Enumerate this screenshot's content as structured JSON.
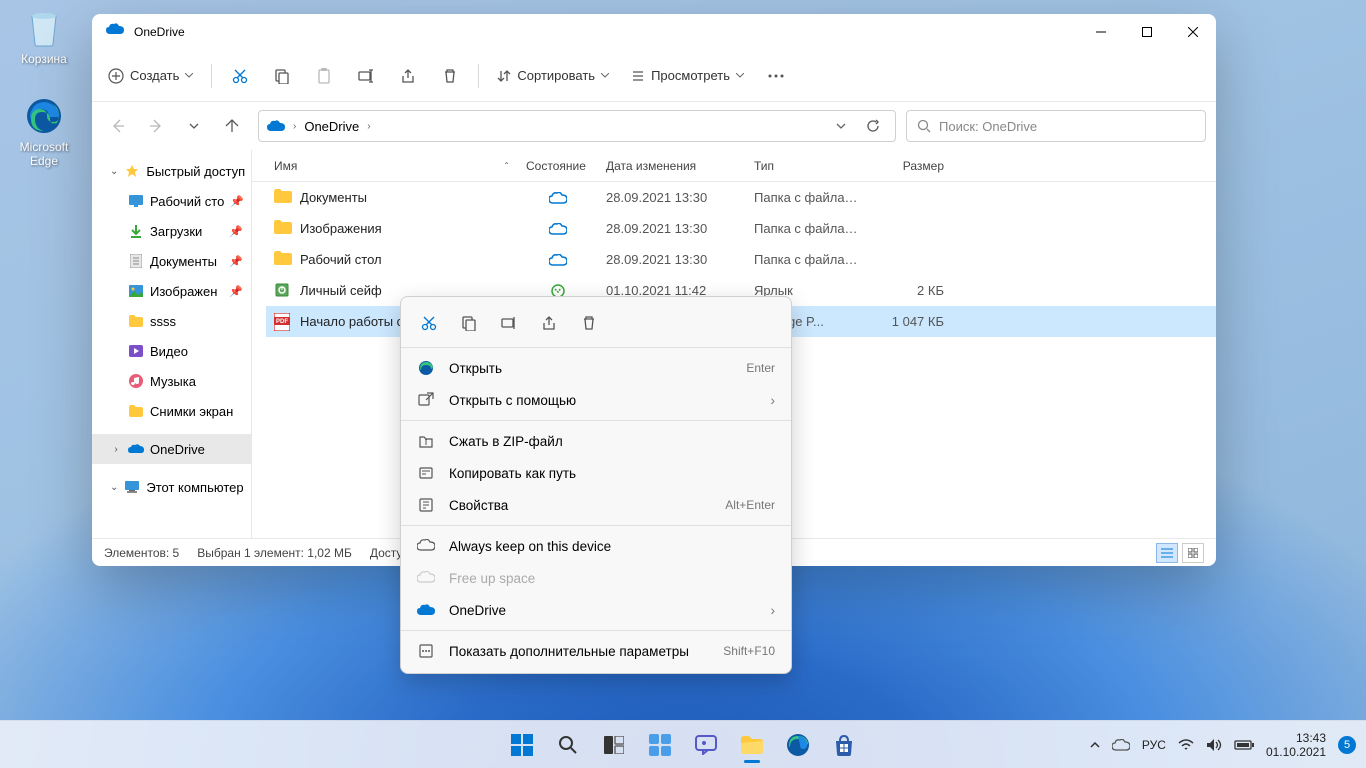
{
  "desktop": {
    "recycle_label": "Корзина",
    "edge_label_1": "Microsoft",
    "edge_label_2": "Edge"
  },
  "window": {
    "title": "OneDrive",
    "toolbar": {
      "new": "Создать",
      "sort": "Сортировать",
      "view": "Просмотреть"
    },
    "breadcrumb": {
      "item": "OneDrive"
    },
    "search": {
      "placeholder": "Поиск: OneDrive"
    },
    "columns": {
      "name": "Имя",
      "status": "Состояние",
      "modified": "Дата изменения",
      "type": "Тип",
      "size": "Размер"
    },
    "files": [
      {
        "name": "Документы",
        "status": "cloud",
        "modified": "28.09.2021 13:30",
        "type": "Папка с файлами",
        "size": "",
        "icon": "folder"
      },
      {
        "name": "Изображения",
        "status": "cloud",
        "modified": "28.09.2021 13:30",
        "type": "Папка с файлами",
        "size": "",
        "icon": "folder"
      },
      {
        "name": "Рабочий стол",
        "status": "cloud",
        "modified": "28.09.2021 13:30",
        "type": "Папка с файлами",
        "size": "",
        "icon": "folder"
      },
      {
        "name": "Личный сейф",
        "status": "sync",
        "modified": "01.10.2021 11:42",
        "type": "Ярлык",
        "size": "2 КБ",
        "icon": "vault"
      },
      {
        "name": "Начало работы с О",
        "status": "",
        "modified": "",
        "type": "oft Edge P...",
        "size": "1 047 КБ",
        "icon": "pdf",
        "selected": true
      }
    ],
    "sidebar": {
      "quick_access": "Быстрый доступ",
      "items": [
        {
          "label": "Рабочий сто",
          "icon": "desktop",
          "pin": true
        },
        {
          "label": "Загрузки",
          "icon": "downloads",
          "pin": true
        },
        {
          "label": "Документы",
          "icon": "documents",
          "pin": true
        },
        {
          "label": "Изображен",
          "icon": "pictures",
          "pin": true
        },
        {
          "label": "ssss",
          "icon": "folder"
        },
        {
          "label": "Видео",
          "icon": "videos"
        },
        {
          "label": "Музыка",
          "icon": "music"
        },
        {
          "label": "Снимки экран",
          "icon": "folder"
        }
      ],
      "onedrive": "OneDrive",
      "thispc": "Этот компьютер"
    },
    "statusbar": {
      "items": "Элементов: 5",
      "selected": "Выбран 1 элемент: 1,02 МБ",
      "available": "Досту"
    }
  },
  "contextmenu": {
    "open": "Открыть",
    "open_shortcut": "Enter",
    "open_with": "Открыть с помощью",
    "zip": "Сжать в ZIP-файл",
    "copy_path": "Копировать как путь",
    "properties": "Свойства",
    "properties_shortcut": "Alt+Enter",
    "always_keep": "Always keep on this device",
    "free_up": "Free up space",
    "onedrive": "OneDrive",
    "show_more": "Показать дополнительные параметры",
    "show_more_shortcut": "Shift+F10"
  },
  "taskbar": {
    "lang": "РУС",
    "time": "13:43",
    "date": "01.10.2021",
    "badge": "5"
  }
}
